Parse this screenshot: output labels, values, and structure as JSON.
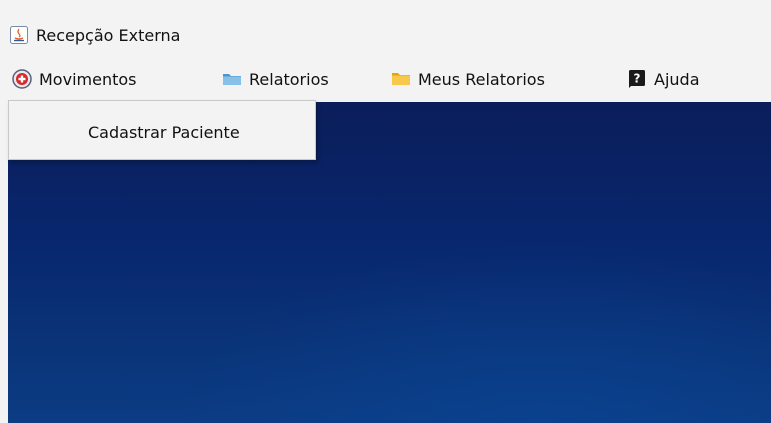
{
  "window": {
    "title": "Recepção Externa",
    "icon": "java-app-icon"
  },
  "menubar": {
    "items": [
      {
        "label": "Movimentos",
        "icon": "medical-shield-icon"
      },
      {
        "label": "Relatorios",
        "icon": "folder-blue-icon"
      },
      {
        "label": "Meus Relatorios",
        "icon": "folder-yellow-icon"
      },
      {
        "label": "Ajuda",
        "icon": "help-icon"
      }
    ]
  },
  "dropdown": {
    "parent": "Movimentos",
    "items": [
      {
        "label": "Cadastrar Paciente"
      }
    ]
  },
  "colors": {
    "desktop_dark": "#0b1e5a",
    "desktop_light": "#0b3c84",
    "menubar_bg": "#f3f3f3"
  }
}
